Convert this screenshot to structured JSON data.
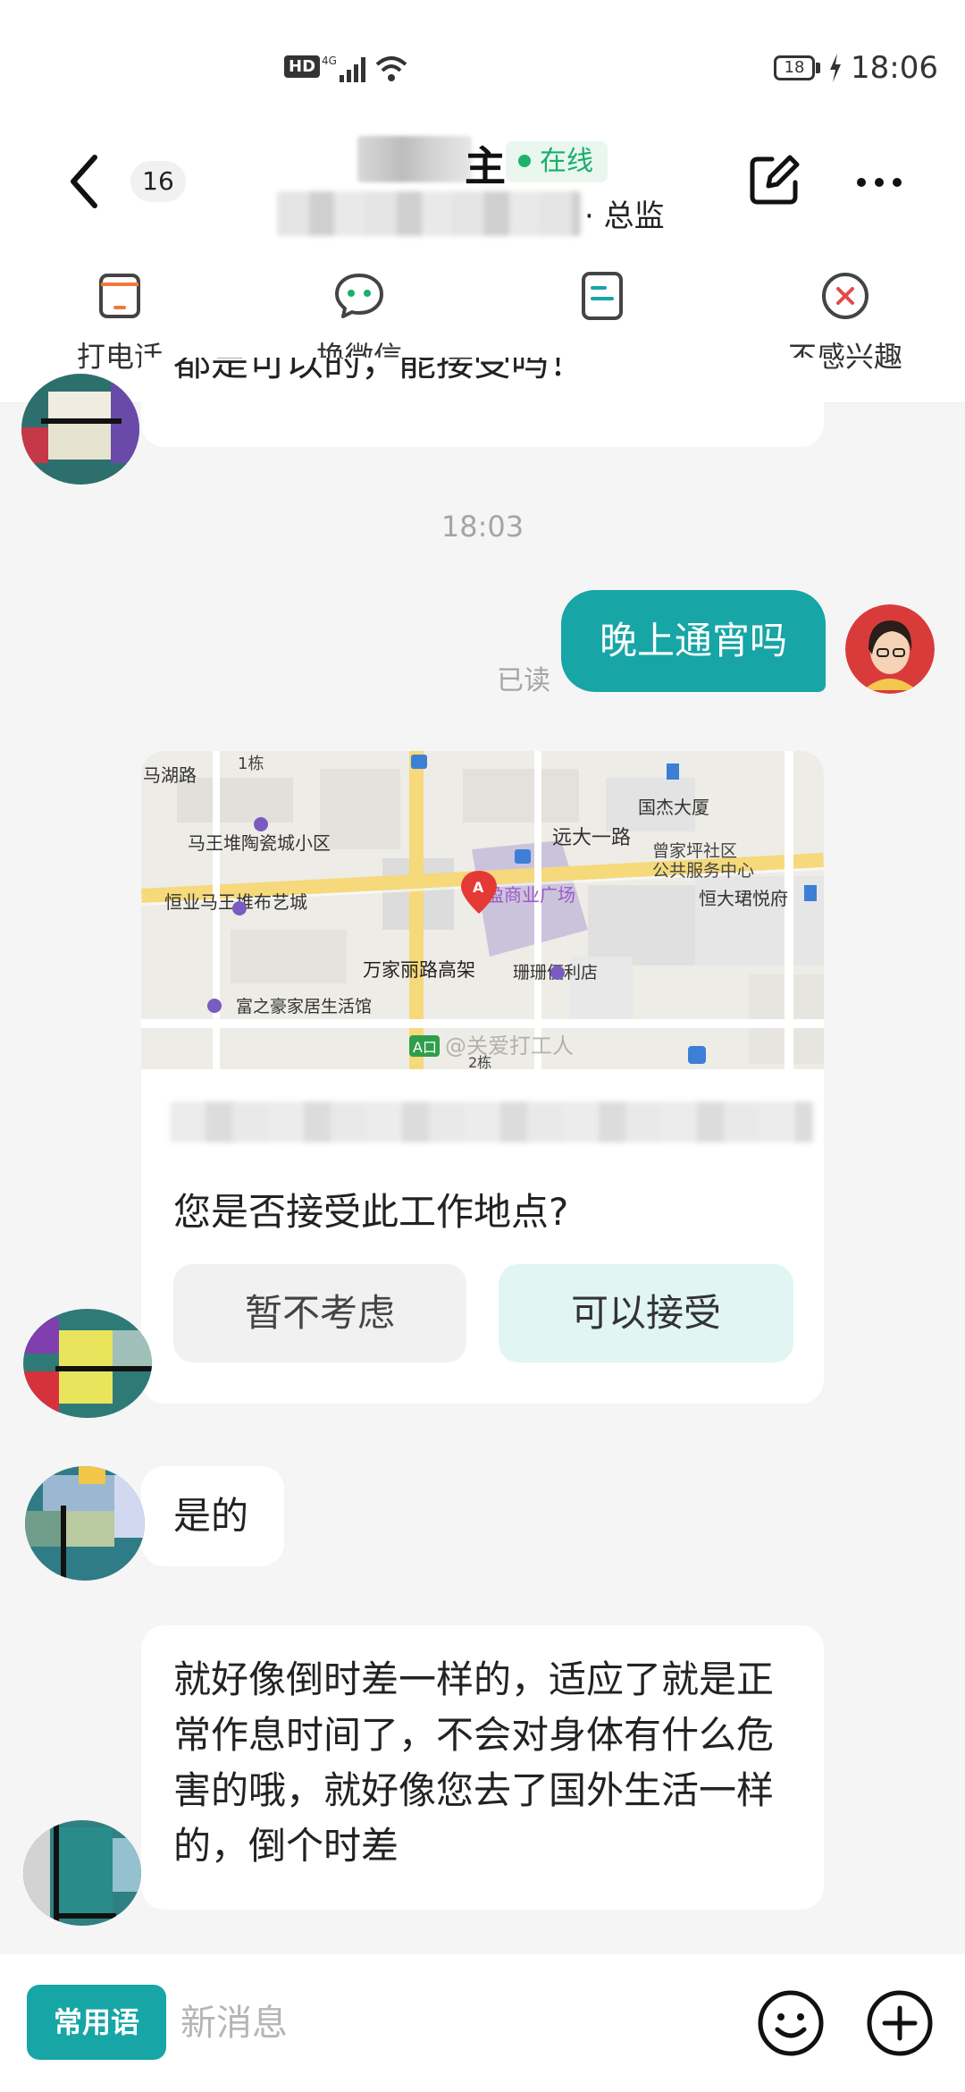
{
  "status_bar": {
    "hd": "HD",
    "network": "4G",
    "battery": "18",
    "time": "18:06"
  },
  "header": {
    "unread_count": "16",
    "name_visible": "主",
    "online_label": "在线",
    "role": "· 总监"
  },
  "actions": [
    {
      "label": "打电话",
      "icon": "phone-icon",
      "color": "#f07a3e"
    },
    {
      "label": "换微信",
      "icon": "wechat-icon",
      "color": "#1bae6b"
    },
    {
      "label": "",
      "icon": "resume-icon",
      "color": "#18a5a6"
    },
    {
      "label": "不感兴趣",
      "icon": "not-interested-icon",
      "color": "#e24b4b"
    }
  ],
  "chat": {
    "partial_message": "都是可以的，能接受吗！",
    "timestamp": "18:03",
    "sent_message": "晚上通宵吗",
    "read_status": "已读",
    "location_card": {
      "map_labels": {
        "road_top_left": "马湖路",
        "building_no": "1栋",
        "community": "马王堆陶瓷城小区",
        "building": "国杰大厦",
        "road_main": "远大一路",
        "service_center_1": "曾家坪社区",
        "service_center_2": "公共服务中心",
        "art_mall": "恒业马王堆布艺城",
        "plaza": "东盈商业广场",
        "hotel": "恒大珺悦府",
        "overpass": "万家丽路高架",
        "store": "珊珊便利店",
        "home_mall": "富之豪家居生活馆",
        "exit": "A口",
        "building_2": "2栋",
        "watermark": "@关爱打工人",
        "pin": "A"
      },
      "question": "您是否接受此工作地点?",
      "reject_label": "暂不考虑",
      "accept_label": "可以接受"
    },
    "reply_short": "是的",
    "reply_long": "就好像倒时差一样的，适应了就是正常作息时间了，不会对身体有什么危害的哦，就好像您去了国外生活一样的，倒个时差"
  },
  "input_bar": {
    "phrases_label": "常用语",
    "placeholder": "新消息"
  },
  "colors": {
    "accent": "#18a5a6",
    "online": "#1bae6b"
  }
}
